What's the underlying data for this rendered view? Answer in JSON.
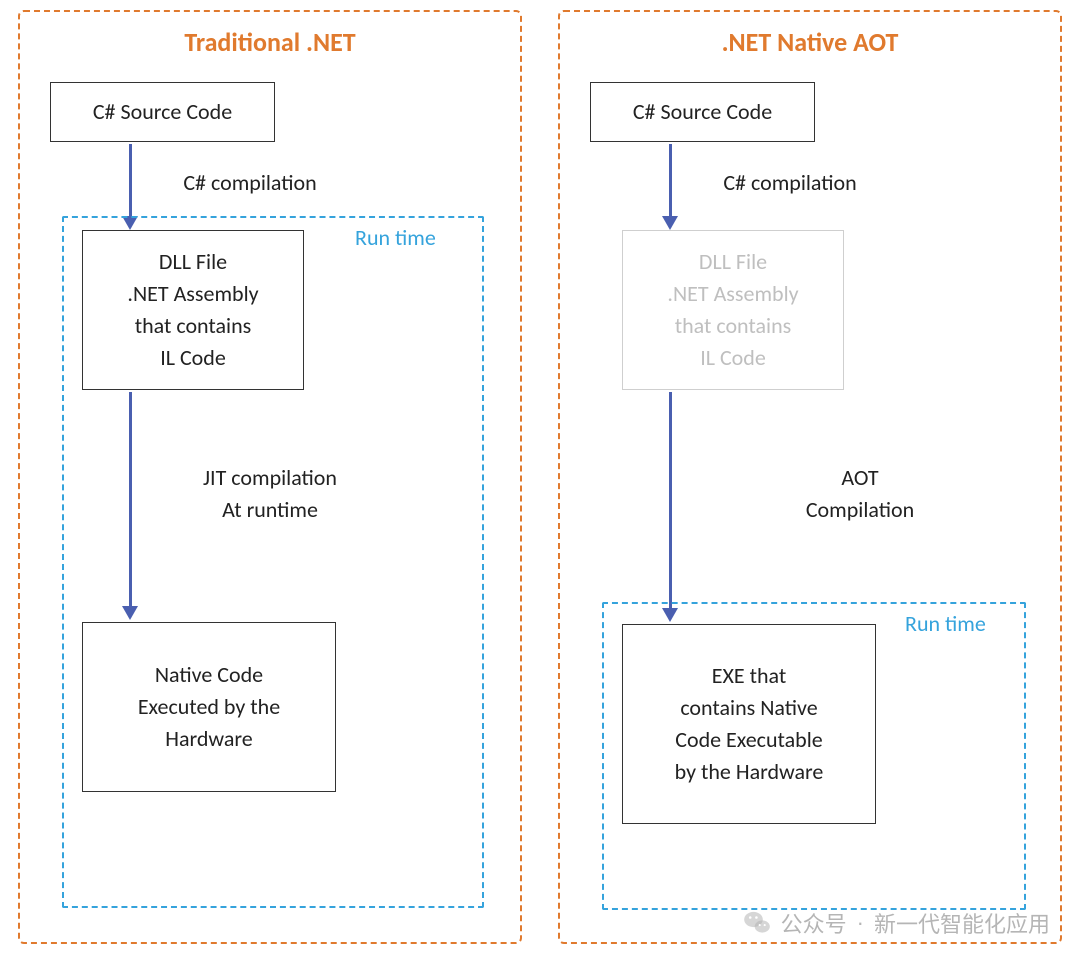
{
  "left": {
    "title": "Traditional .NET",
    "box1": "C# Source Code",
    "arrow1_label": "C# compilation",
    "box2": "DLL File\n.NET Assembly\nthat contains\nIL Code",
    "arrow2_label": "JIT compilation\nAt runtime",
    "box3": "Native Code\nExecuted by the\nHardware",
    "runtime_label": "Run time"
  },
  "right": {
    "title": ".NET Native AOT",
    "box1": "C# Source Code",
    "arrow1_label": "C# compilation",
    "box2_faded": "DLL File\n.NET Assembly\nthat contains\nIL Code",
    "arrow2_label": "AOT\nCompilation",
    "box3": "EXE that\ncontains Native\nCode Executable\nby the Hardware",
    "runtime_label": "Run time"
  },
  "watermark": {
    "prefix": "公众号",
    "dot": "·",
    "text": "新一代智能化应用"
  }
}
